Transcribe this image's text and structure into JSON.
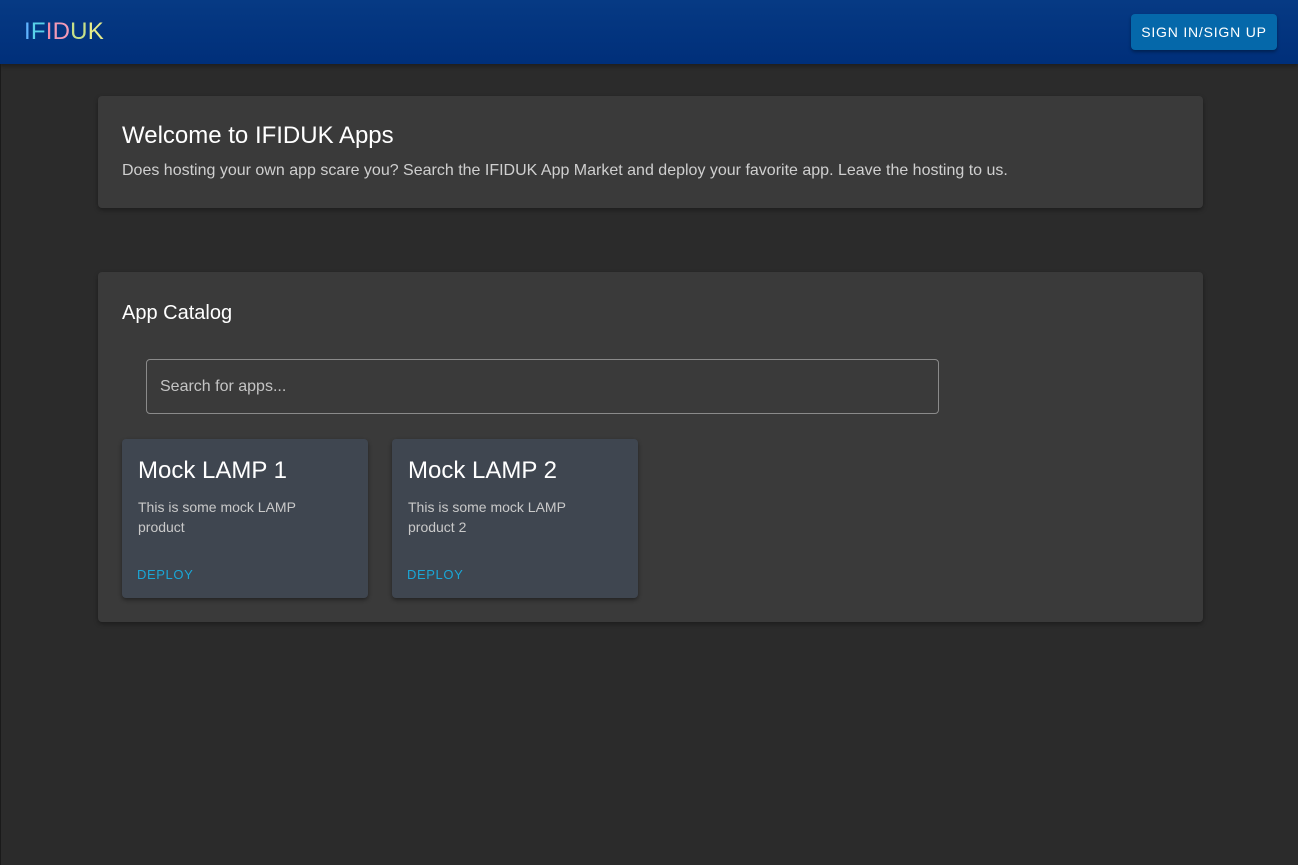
{
  "header": {
    "logo_letters": [
      {
        "char": "I",
        "color": "#5fb3ff"
      },
      {
        "char": "F",
        "color": "#58d0e8"
      },
      {
        "char": "I",
        "color": "#f08aa8"
      },
      {
        "char": "D",
        "color": "#f29ab6"
      },
      {
        "char": "U",
        "color": "#c6e089"
      },
      {
        "char": "K",
        "color": "#e6ec8a"
      }
    ],
    "sign_in_label": "SIGN IN/SIGN UP"
  },
  "welcome": {
    "title": "Welcome to IFIDUK Apps",
    "text": "Does hosting your own app scare you? Search the IFIDUK App Market and deploy your favorite app. Leave the hosting to us."
  },
  "catalog": {
    "title": "App Catalog",
    "search_placeholder": "Search for apps...",
    "search_value": "",
    "apps": [
      {
        "name": "Mock LAMP 1",
        "description": "This is some mock LAMP product",
        "action_label": "DEPLOY"
      },
      {
        "name": "Mock LAMP 2",
        "description": "This is some mock LAMP product 2",
        "action_label": "DEPLOY"
      }
    ]
  },
  "colors": {
    "app_bar": "#002f7a",
    "background": "#2b2b2b",
    "panel": "#3a3a3a",
    "card": "#3f4650",
    "accent_button": "#0568aa",
    "deploy_text": "#1aa6d6"
  }
}
